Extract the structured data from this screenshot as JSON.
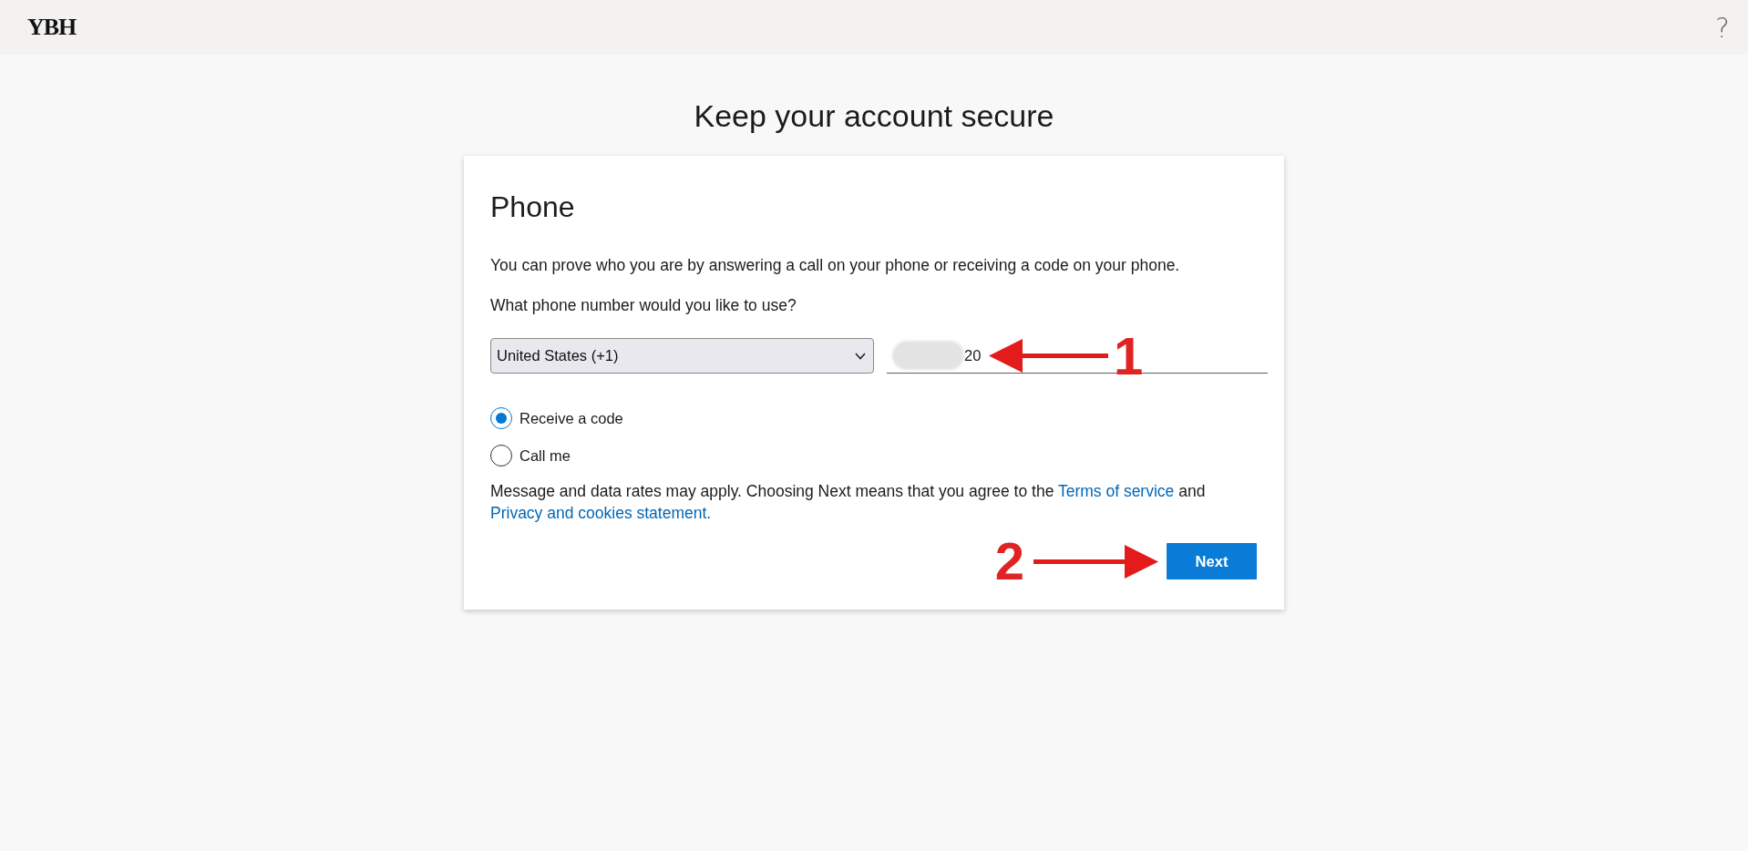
{
  "header": {
    "logo": "YBH",
    "help": "?"
  },
  "title": "Keep your account secure",
  "card": {
    "heading": "Phone",
    "description": "You can prove who you are by answering a call on your phone or receiving a code on your phone.",
    "question": "What phone number would you like to use?",
    "country_select": {
      "value": "United States (+1)"
    },
    "phone_number": {
      "value": "20",
      "redacted": true,
      "callout": "1"
    },
    "options": [
      {
        "label": "Receive a code",
        "selected": true
      },
      {
        "label": "Call me",
        "selected": false
      }
    ],
    "disclaimer": [
      {
        "kind": "text",
        "text": "Message and data rates may apply. Choosing Next means that you agree to the"
      },
      {
        "kind": "link",
        "text": "Terms of service"
      },
      {
        "kind": "text",
        "text": "and"
      },
      {
        "kind": "link",
        "text": "Privacy and cookies statement."
      }
    ],
    "next_button": {
      "label": "Next",
      "callout": "2"
    }
  }
}
